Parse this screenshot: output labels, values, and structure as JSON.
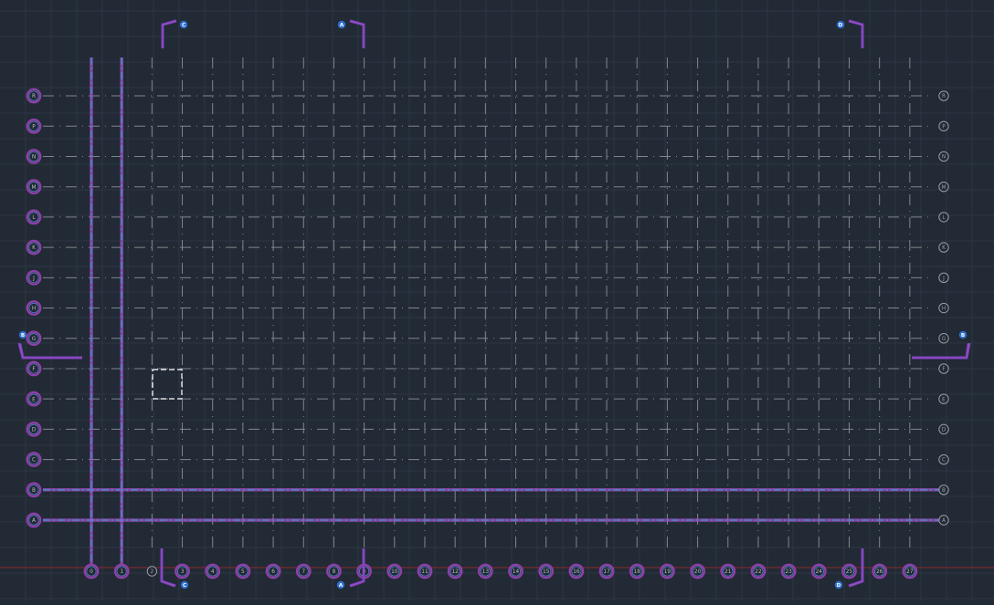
{
  "colors": {
    "background": "#222a35",
    "fine_grid": "#2c3542",
    "grid_line": "#8c9098",
    "bubble_plain": "#9a9ea6",
    "bubble_selected": "#8e3fa8",
    "highlight": "#a24fc4",
    "selected_line": "#4f83c8",
    "section_marker": "#6a3fb0",
    "tag_fill": "#2e6fd1",
    "tag_text": "#ffffff",
    "ucs_red": "#8b2a2a",
    "selection_box": "#ffffff"
  },
  "grid": {
    "row_labels": [
      "A",
      "B",
      "C",
      "D",
      "E",
      "F",
      "G",
      "H",
      "J",
      "K",
      "L",
      "M",
      "N",
      "P",
      "R"
    ],
    "column_labels": [
      "0",
      "1",
      "2",
      "3",
      "4",
      "5",
      "6",
      "7",
      "8",
      "9",
      "10",
      "11",
      "12",
      "13",
      "14",
      "15",
      "16",
      "17",
      "18",
      "19",
      "20",
      "21",
      "22",
      "23",
      "24",
      "25",
      "26",
      "27"
    ],
    "selected_rows": [
      "A",
      "B"
    ],
    "selected_columns": [
      "0",
      "1"
    ],
    "highlighted_left_bubbles": [
      "A",
      "B",
      "C",
      "D",
      "E",
      "F",
      "G",
      "H",
      "J",
      "K",
      "L",
      "M",
      "N",
      "P",
      "R"
    ],
    "highlighted_bottom_bubbles": [
      "0",
      "1",
      "3",
      "4",
      "5",
      "6",
      "7",
      "8",
      "9",
      "10",
      "11",
      "12",
      "13",
      "14",
      "15",
      "16",
      "17",
      "18",
      "19",
      "20",
      "21",
      "22",
      "23",
      "24",
      "25",
      "26",
      "27"
    ]
  },
  "section_markers": [
    {
      "id": "C-top",
      "tag": "C"
    },
    {
      "id": "A-top",
      "tag": "A"
    },
    {
      "id": "D-top",
      "tag": "D"
    },
    {
      "id": "C-bottom",
      "tag": "C"
    },
    {
      "id": "A-bottom",
      "tag": "A"
    },
    {
      "id": "D-bottom",
      "tag": "D"
    },
    {
      "id": "B-left",
      "tag": "B"
    },
    {
      "id": "B-right",
      "tag": "B"
    }
  ]
}
